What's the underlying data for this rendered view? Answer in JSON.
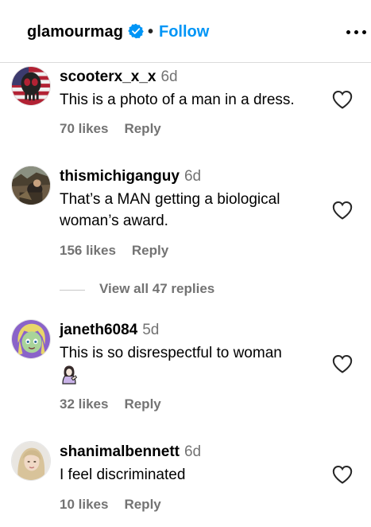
{
  "header": {
    "username": "glamourmag",
    "separator": "•",
    "follow_label": "Follow",
    "verified_color": "#0095f6"
  },
  "comments": [
    {
      "username": "scooterx_x_x",
      "age": "6d",
      "text": "This is a photo of a man in a dress.",
      "likes": "70 likes",
      "reply_label": "Reply",
      "avatar": "punisher-skull-flag-avatar"
    },
    {
      "username": "thismichiganguy",
      "age": "6d",
      "text": "That’s a MAN getting a biological woman’s award.",
      "likes": "156 likes",
      "reply_label": "Reply",
      "avatar": "outdoor-photo-avatar"
    },
    {
      "username": "janeth6084",
      "age": "5d",
      "text": "This is so disrespectful to woman",
      "emoji": "woman-tipping-hand-emoji",
      "likes": "32 likes",
      "reply_label": "Reply",
      "avatar": "cartoon-girl-avatar"
    },
    {
      "username": "shanimalbennett",
      "age": "6d",
      "text": "I feel discriminated",
      "likes": "10 likes",
      "reply_label": "Reply",
      "avatar": "blonde-woman-avatar"
    }
  ],
  "view_replies": {
    "label": "View all 47 replies"
  }
}
